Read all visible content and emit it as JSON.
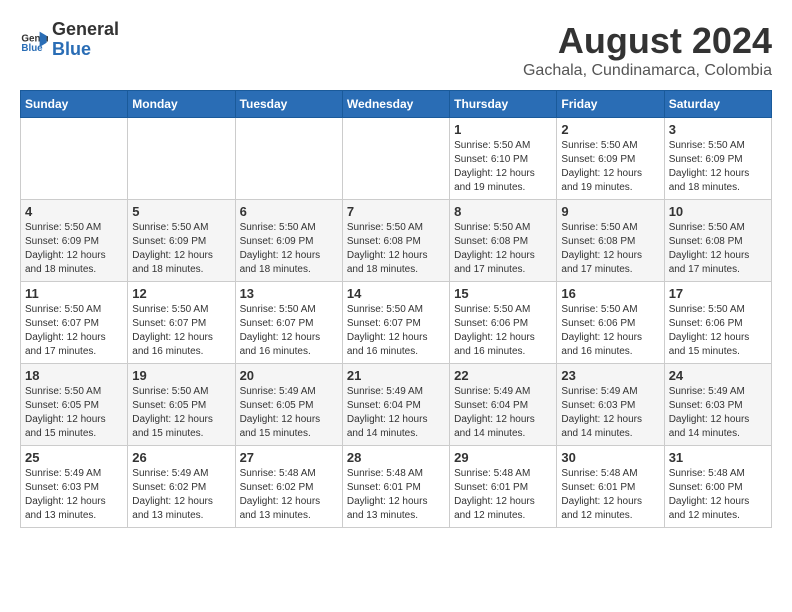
{
  "logo": {
    "general": "General",
    "blue": "Blue"
  },
  "title": "August 2024",
  "subtitle": "Gachala, Cundinamarca, Colombia",
  "days_of_week": [
    "Sunday",
    "Monday",
    "Tuesday",
    "Wednesday",
    "Thursday",
    "Friday",
    "Saturday"
  ],
  "weeks": [
    [
      {
        "day": "",
        "info": ""
      },
      {
        "day": "",
        "info": ""
      },
      {
        "day": "",
        "info": ""
      },
      {
        "day": "",
        "info": ""
      },
      {
        "day": "1",
        "info": "Sunrise: 5:50 AM\nSunset: 6:10 PM\nDaylight: 12 hours\nand 19 minutes."
      },
      {
        "day": "2",
        "info": "Sunrise: 5:50 AM\nSunset: 6:09 PM\nDaylight: 12 hours\nand 19 minutes."
      },
      {
        "day": "3",
        "info": "Sunrise: 5:50 AM\nSunset: 6:09 PM\nDaylight: 12 hours\nand 18 minutes."
      }
    ],
    [
      {
        "day": "4",
        "info": "Sunrise: 5:50 AM\nSunset: 6:09 PM\nDaylight: 12 hours\nand 18 minutes."
      },
      {
        "day": "5",
        "info": "Sunrise: 5:50 AM\nSunset: 6:09 PM\nDaylight: 12 hours\nand 18 minutes."
      },
      {
        "day": "6",
        "info": "Sunrise: 5:50 AM\nSunset: 6:09 PM\nDaylight: 12 hours\nand 18 minutes."
      },
      {
        "day": "7",
        "info": "Sunrise: 5:50 AM\nSunset: 6:08 PM\nDaylight: 12 hours\nand 18 minutes."
      },
      {
        "day": "8",
        "info": "Sunrise: 5:50 AM\nSunset: 6:08 PM\nDaylight: 12 hours\nand 17 minutes."
      },
      {
        "day": "9",
        "info": "Sunrise: 5:50 AM\nSunset: 6:08 PM\nDaylight: 12 hours\nand 17 minutes."
      },
      {
        "day": "10",
        "info": "Sunrise: 5:50 AM\nSunset: 6:08 PM\nDaylight: 12 hours\nand 17 minutes."
      }
    ],
    [
      {
        "day": "11",
        "info": "Sunrise: 5:50 AM\nSunset: 6:07 PM\nDaylight: 12 hours\nand 17 minutes."
      },
      {
        "day": "12",
        "info": "Sunrise: 5:50 AM\nSunset: 6:07 PM\nDaylight: 12 hours\nand 16 minutes."
      },
      {
        "day": "13",
        "info": "Sunrise: 5:50 AM\nSunset: 6:07 PM\nDaylight: 12 hours\nand 16 minutes."
      },
      {
        "day": "14",
        "info": "Sunrise: 5:50 AM\nSunset: 6:07 PM\nDaylight: 12 hours\nand 16 minutes."
      },
      {
        "day": "15",
        "info": "Sunrise: 5:50 AM\nSunset: 6:06 PM\nDaylight: 12 hours\nand 16 minutes."
      },
      {
        "day": "16",
        "info": "Sunrise: 5:50 AM\nSunset: 6:06 PM\nDaylight: 12 hours\nand 16 minutes."
      },
      {
        "day": "17",
        "info": "Sunrise: 5:50 AM\nSunset: 6:06 PM\nDaylight: 12 hours\nand 15 minutes."
      }
    ],
    [
      {
        "day": "18",
        "info": "Sunrise: 5:50 AM\nSunset: 6:05 PM\nDaylight: 12 hours\nand 15 minutes."
      },
      {
        "day": "19",
        "info": "Sunrise: 5:50 AM\nSunset: 6:05 PM\nDaylight: 12 hours\nand 15 minutes."
      },
      {
        "day": "20",
        "info": "Sunrise: 5:49 AM\nSunset: 6:05 PM\nDaylight: 12 hours\nand 15 minutes."
      },
      {
        "day": "21",
        "info": "Sunrise: 5:49 AM\nSunset: 6:04 PM\nDaylight: 12 hours\nand 14 minutes."
      },
      {
        "day": "22",
        "info": "Sunrise: 5:49 AM\nSunset: 6:04 PM\nDaylight: 12 hours\nand 14 minutes."
      },
      {
        "day": "23",
        "info": "Sunrise: 5:49 AM\nSunset: 6:03 PM\nDaylight: 12 hours\nand 14 minutes."
      },
      {
        "day": "24",
        "info": "Sunrise: 5:49 AM\nSunset: 6:03 PM\nDaylight: 12 hours\nand 14 minutes."
      }
    ],
    [
      {
        "day": "25",
        "info": "Sunrise: 5:49 AM\nSunset: 6:03 PM\nDaylight: 12 hours\nand 13 minutes."
      },
      {
        "day": "26",
        "info": "Sunrise: 5:49 AM\nSunset: 6:02 PM\nDaylight: 12 hours\nand 13 minutes."
      },
      {
        "day": "27",
        "info": "Sunrise: 5:48 AM\nSunset: 6:02 PM\nDaylight: 12 hours\nand 13 minutes."
      },
      {
        "day": "28",
        "info": "Sunrise: 5:48 AM\nSunset: 6:01 PM\nDaylight: 12 hours\nand 13 minutes."
      },
      {
        "day": "29",
        "info": "Sunrise: 5:48 AM\nSunset: 6:01 PM\nDaylight: 12 hours\nand 12 minutes."
      },
      {
        "day": "30",
        "info": "Sunrise: 5:48 AM\nSunset: 6:01 PM\nDaylight: 12 hours\nand 12 minutes."
      },
      {
        "day": "31",
        "info": "Sunrise: 5:48 AM\nSunset: 6:00 PM\nDaylight: 12 hours\nand 12 minutes."
      }
    ]
  ]
}
